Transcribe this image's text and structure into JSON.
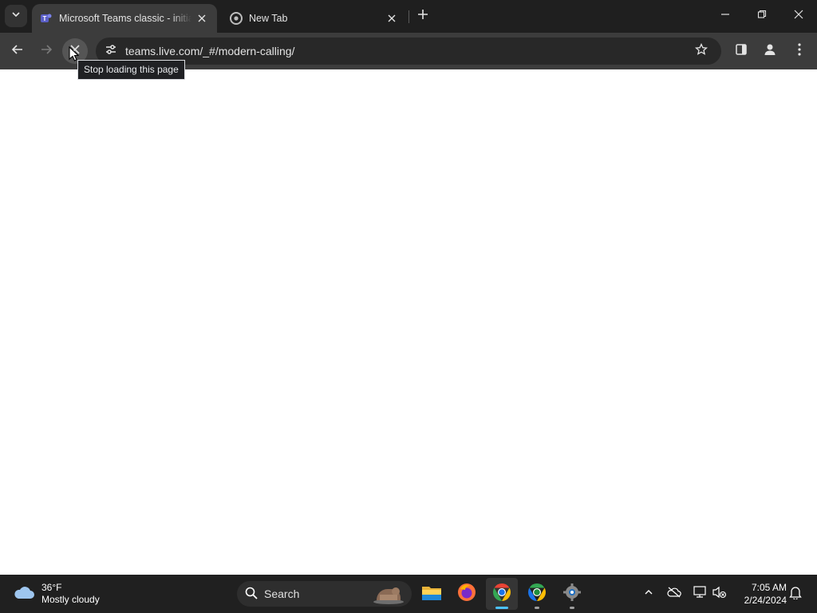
{
  "browser": {
    "tabs": [
      {
        "title": "Microsoft Teams classic - initializing",
        "active": true,
        "favicon": "teams-icon"
      },
      {
        "title": "New Tab",
        "active": false,
        "favicon": "chrome-icon"
      }
    ],
    "url": "teams.live.com/_#/modern-calling/",
    "tooltip": "Stop loading this page"
  },
  "taskbar": {
    "weather": {
      "temp": "36°F",
      "condition": "Mostly cloudy",
      "icon": "cloud-icon"
    },
    "search_label": "Search",
    "apps": [
      "file-explorer-icon",
      "firefox-icon",
      "chrome-icon",
      "chrome-profile-icon",
      "settings-icon"
    ],
    "clock": {
      "time": "7:05 AM",
      "date": "2/24/2024"
    }
  },
  "colors": {
    "tab_strip": "#1f1f1f",
    "toolbar": "#3c3c3c",
    "omnibox": "#282828",
    "taskbar": "#202020",
    "accent": "#4cc2ff"
  }
}
